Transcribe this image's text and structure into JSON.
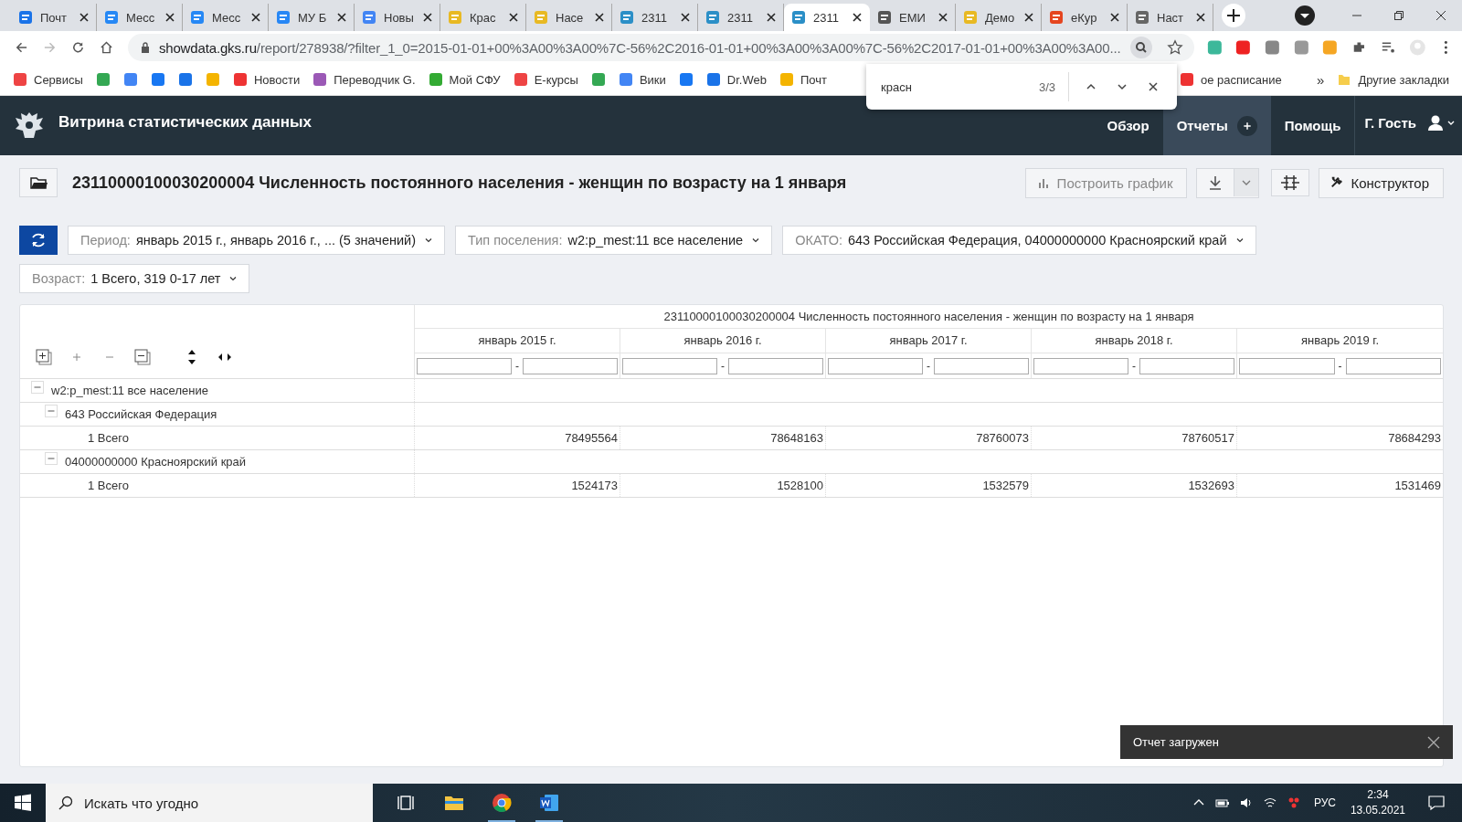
{
  "browser": {
    "tabs": [
      {
        "title": "Почт",
        "selected": false
      },
      {
        "title": "Месс",
        "selected": false
      },
      {
        "title": "Месс",
        "selected": false
      },
      {
        "title": "МУ Б",
        "selected": false
      },
      {
        "title": "Новы",
        "selected": false
      },
      {
        "title": "Крас",
        "selected": false
      },
      {
        "title": "Насе",
        "selected": false
      },
      {
        "title": "2311",
        "selected": false
      },
      {
        "title": "2311",
        "selected": false
      },
      {
        "title": "2311",
        "selected": true
      },
      {
        "title": "ЕМИ",
        "selected": false
      },
      {
        "title": "Демо",
        "selected": false
      },
      {
        "title": "еКур",
        "selected": false
      },
      {
        "title": "Наст",
        "selected": false
      }
    ],
    "address": {
      "host": "showdata.gks.ru",
      "path": "/report/278938/?filter_1_0=2015-01-01+00%3A00%3A00%7C-56%2C2016-01-01+00%3A00%3A00%7C-56%2C2017-01-01+00%3A00%3A00..."
    },
    "bookmarks": [
      {
        "kind": "link",
        "label": "Сервисы"
      },
      {
        "kind": "icon"
      },
      {
        "kind": "icon"
      },
      {
        "kind": "icon"
      },
      {
        "kind": "icon"
      },
      {
        "kind": "icon"
      },
      {
        "kind": "link",
        "label": "Новости"
      },
      {
        "kind": "link",
        "label": "Переводчик G."
      },
      {
        "kind": "link",
        "label": "Мой СФУ"
      },
      {
        "kind": "link",
        "label": "E-курсы"
      },
      {
        "kind": "icon"
      },
      {
        "kind": "link",
        "label": "Вики"
      },
      {
        "kind": "icon"
      },
      {
        "kind": "link",
        "label": "Dr.Web"
      },
      {
        "kind": "link",
        "label": "Почт"
      },
      {
        "kind": "link",
        "label": "ое расписание"
      }
    ],
    "more": "»",
    "other_bookmarks": "Другие закладки",
    "find": {
      "query": "красн",
      "count": "3/3"
    }
  },
  "app": {
    "title": "Витрина статистических данных",
    "nav": [
      {
        "label": "Обзор",
        "selected": false
      },
      {
        "label": "Отчеты",
        "selected": true
      },
      {
        "label": "Помощь",
        "selected": false
      }
    ],
    "user": "Г. Гость"
  },
  "report": {
    "title": "23110000100030200004 Численность постоянного населения - женщин по возрасту на 1 января",
    "chart_button": {
      "label": "Построить график",
      "disabled": true
    },
    "constructor_button": "Конструктор",
    "filters": [
      {
        "label": "Период:",
        "value": "январь 2015 г., январь 2016 г., ... (5 значений)"
      },
      {
        "label": "Тип поселения:",
        "value": "w2:p_mest:11 все население"
      },
      {
        "label": "ОКАТО:",
        "value": "643 Российская Федерация, 04000000000 Красноярский край"
      },
      {
        "label": "Возраст:",
        "value": "1 Всего, 319 0-17 лет"
      }
    ]
  },
  "table": {
    "title": "23110000100030200004 Численность постоянного населения - женщин по возрасту на 1 января",
    "columns": [
      {
        "label": "январь 2015 г.",
        "separator": "-"
      },
      {
        "label": "январь 2016 г.",
        "separator": "-"
      },
      {
        "label": "январь 2017 г.",
        "separator": "-"
      },
      {
        "label": "январь 2018 г.",
        "separator": "-"
      },
      {
        "label": "январь 2019 г.",
        "separator": "-"
      }
    ],
    "rows": [
      {
        "label": "w2:p_mest:11 все население",
        "expanded": true,
        "children": [
          {
            "label": "643 Российская Федерация",
            "expanded": true,
            "children": [
              {
                "label": "1 Всего",
                "values": [
                  "78495564",
                  "78648163",
                  "78760073",
                  "78760517",
                  "78684293"
                ]
              }
            ]
          },
          {
            "label": "04000000000 Красноярский край",
            "expanded": true,
            "children": [
              {
                "label": "1 Всего",
                "values": [
                  "1524173",
                  "1528100",
                  "1532579",
                  "1532693",
                  "1531469"
                ]
              }
            ]
          }
        ]
      }
    ]
  },
  "toast": "Отчет загружен",
  "taskbar": {
    "search_placeholder": "Искать что угодно",
    "language": "РУС",
    "time": "2:34",
    "date": "13.05.2021"
  }
}
